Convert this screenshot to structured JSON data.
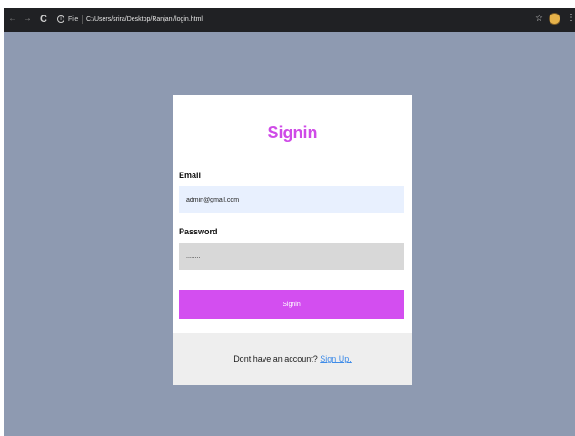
{
  "browser": {
    "file_label": "File",
    "url": "C:/Users/srira/Desktop/Ranjani/login.html"
  },
  "signin": {
    "title": "Signin",
    "email_label": "Email",
    "email_value": "admin@gmail.com",
    "password_label": "Password",
    "password_value": "........",
    "button_label": "Signin",
    "footer_text": "Dont have an account?",
    "signup_link": "Sign Up."
  },
  "colors": {
    "page_bg": "#8e9ab1",
    "accent": "#d34ef0",
    "link": "#3f8ce8",
    "email_bg": "#e8f0fe",
    "password_bg": "#d8d8d8"
  },
  "icons": [
    "back-arrow-icon",
    "forward-arrow-icon",
    "reload-icon",
    "info-icon",
    "star-icon",
    "avatar",
    "menu-dots-icon"
  ]
}
